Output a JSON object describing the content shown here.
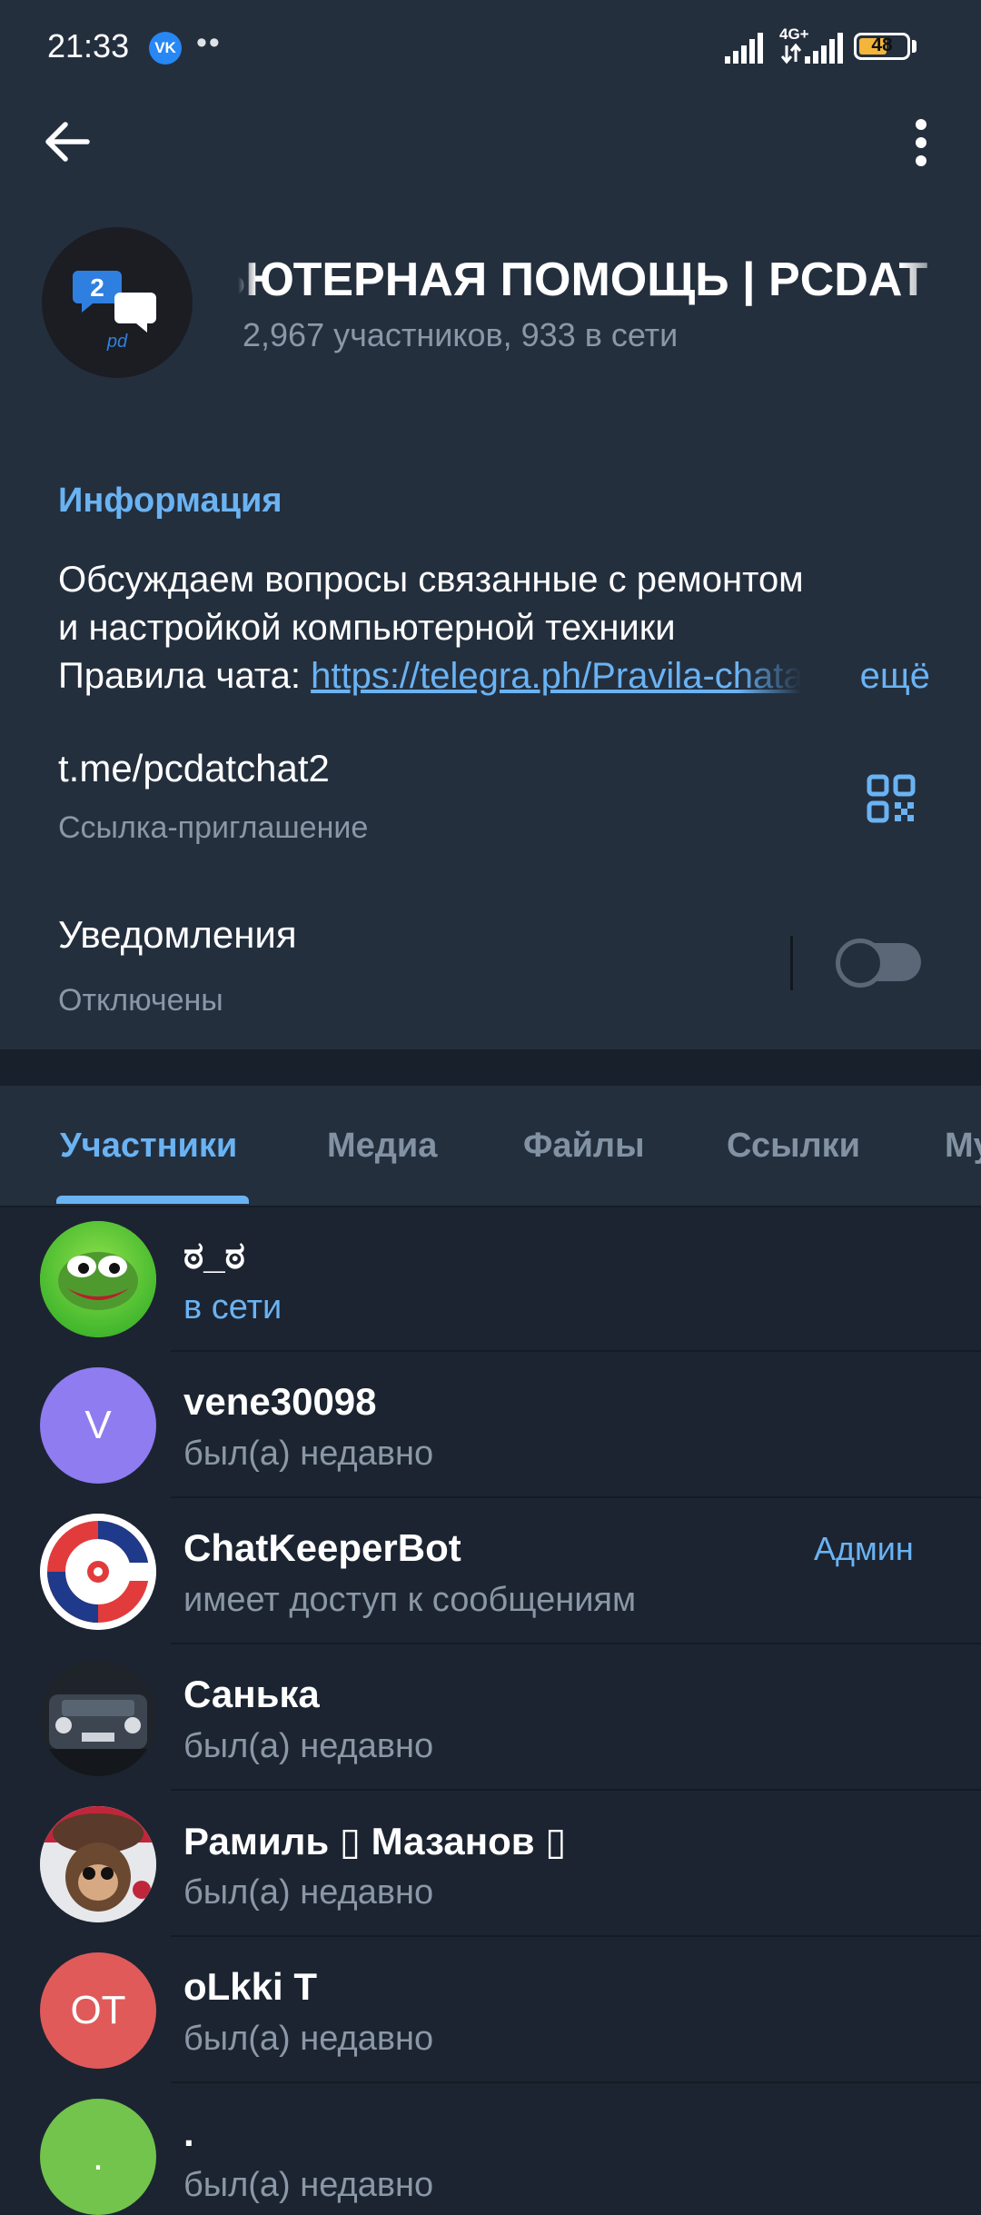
{
  "status_bar": {
    "time": "21:33",
    "vk_badge": "VK",
    "dots": "••",
    "network": "4G+",
    "battery": "48"
  },
  "header": {
    "title": "КОМПЬЮТЕРНАЯ ПОМОЩЬ | PCDAT",
    "subtitle": "2,967 участников, 933 в сети",
    "avatar_badge": "2",
    "avatar_logo": "pd"
  },
  "info": {
    "heading": "Информация",
    "description_line1": "Обсуждаем вопросы связанные с ремонтом",
    "description_line2": "и настройкой компьютерной техники",
    "rules_prefix": "Правила чата: ",
    "rules_link": "https://telegra.ph/Pravila-chata",
    "more": "ещё",
    "invite_link": "t.me/pcdatchat2",
    "invite_caption": "Ссылка-приглашение",
    "notifications_label": "Уведомления",
    "notifications_state": "Отключены"
  },
  "tabs": [
    {
      "label": "Участники",
      "active": true
    },
    {
      "label": "Медиа"
    },
    {
      "label": "Файлы"
    },
    {
      "label": "Ссылки"
    },
    {
      "label": "Му"
    }
  ],
  "members": [
    {
      "name": "ಠ_ಠ",
      "status": "в сети",
      "online": true,
      "avatar": "pepe-avatar",
      "avatar_color": "#7fd43a"
    },
    {
      "name": "vene30098",
      "status": "был(а) недавно",
      "initials": "V",
      "avatar_color": "#8e7cf0"
    },
    {
      "name": "ChatKeeperBot",
      "status": "имеет доступ к сообщениям",
      "role": "Админ",
      "avatar": "chatkeeper-avatar"
    },
    {
      "name": "Санька",
      "status": "был(а) недавно",
      "avatar": "car-photo-avatar"
    },
    {
      "name": "Рамиль ▯ Мазанов ▯",
      "status": "был(а) недавно",
      "avatar": "monkey-photo-avatar"
    },
    {
      "name": "oLkki T",
      "status": "был(а) недавно",
      "initials": "OT",
      "avatar_color": "#e05a5a"
    },
    {
      "name": ".",
      "status": "был(а) недавно",
      "initials": ".",
      "avatar_color": "#72c44c"
    }
  ],
  "colors": {
    "accent": "#6ab3f3",
    "header_bg": "#242f3e",
    "list_bg": "#1c2431",
    "muted": "#8a97a6"
  }
}
